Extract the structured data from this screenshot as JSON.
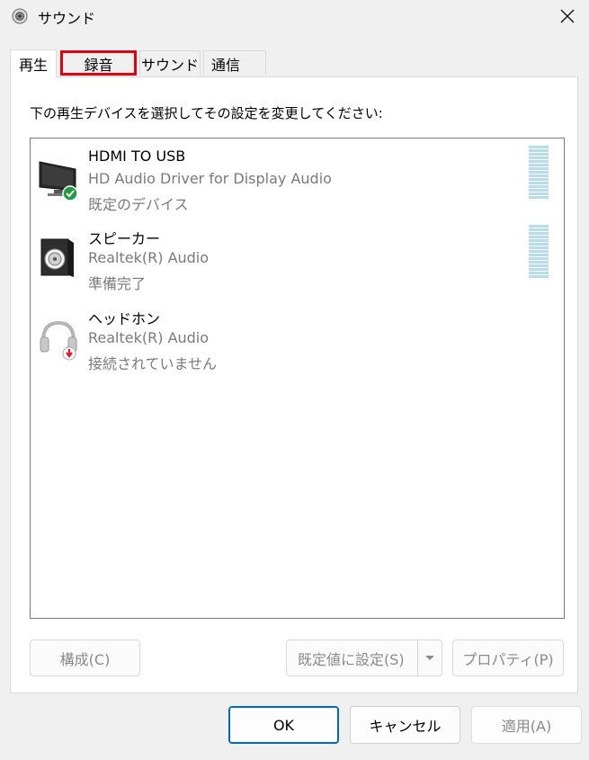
{
  "window": {
    "title": "サウンド"
  },
  "tabs": [
    {
      "label": "再生",
      "active": true
    },
    {
      "label": "録音",
      "highlighted": true
    },
    {
      "label": "サウンド"
    },
    {
      "label": "通信"
    }
  ],
  "instruction": "下の再生デバイスを選択してその設定を変更してください:",
  "devices": [
    {
      "name": "HDMI TO USB",
      "driver": "HD Audio Driver for Display Audio",
      "status": "既定のデバイス",
      "icon": "monitor-icon",
      "badge": "check-badge-icon"
    },
    {
      "name": "スピーカー",
      "driver": "Realtek(R) Audio",
      "status": "準備完了",
      "icon": "speaker-icon"
    },
    {
      "name": "ヘッドホン",
      "driver": "Realtek(R) Audio",
      "status": "接続されていません",
      "icon": "headphones-icon",
      "badge": "unplugged-badge-icon"
    }
  ],
  "buttons": {
    "configure": "構成(C)",
    "set_default": "既定値に設定(S)",
    "properties": "プロパティ(P)",
    "ok": "OK",
    "cancel": "キャンセル",
    "apply": "適用(A)"
  },
  "colors": {
    "highlight": "#e00010",
    "accent": "#0067c0",
    "meter": "#b9dce9",
    "check": "#1e9e3e",
    "warning": "#e81123"
  }
}
